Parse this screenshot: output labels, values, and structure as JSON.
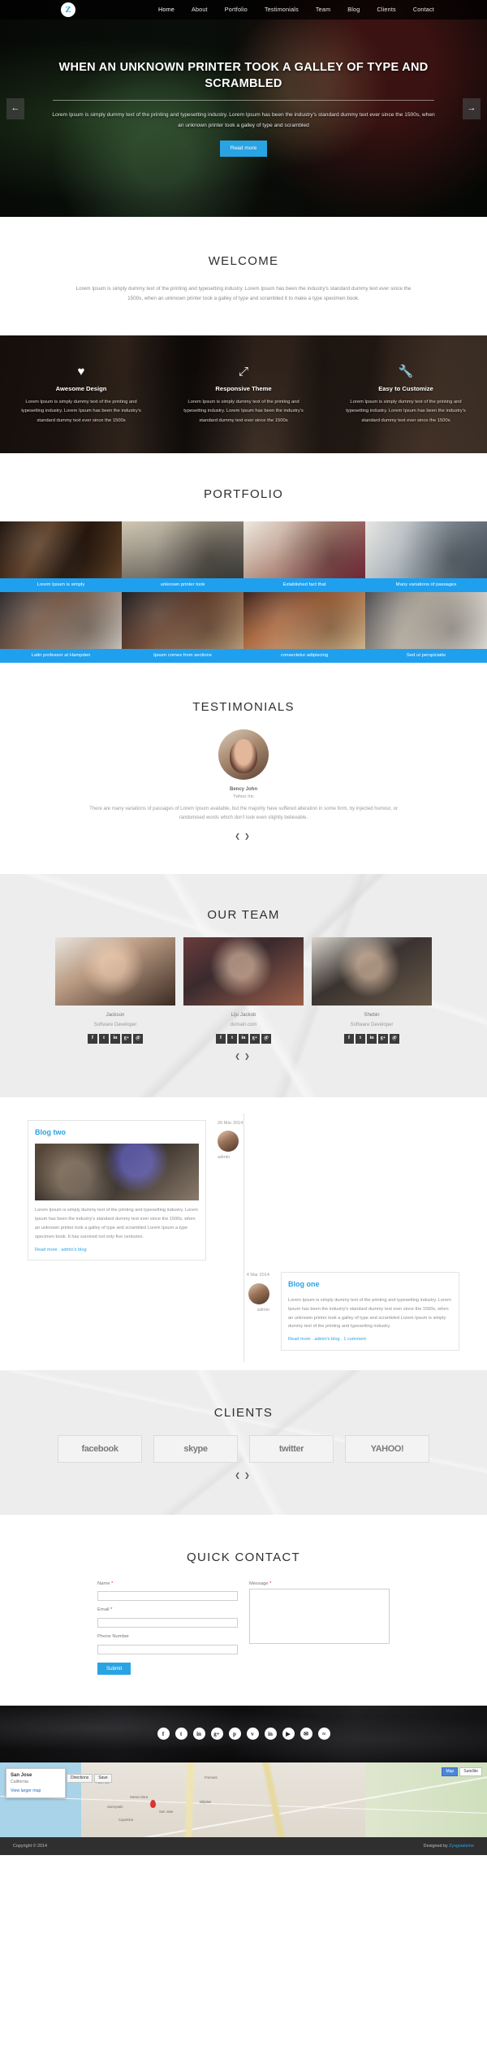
{
  "header": {
    "logo_text": "Z",
    "nav": [
      {
        "label": "Home"
      },
      {
        "label": "About"
      },
      {
        "label": "Portfolio"
      },
      {
        "label": "Testimonials"
      },
      {
        "label": "Team"
      },
      {
        "label": "Blog"
      },
      {
        "label": "Clients"
      },
      {
        "label": "Contact"
      }
    ]
  },
  "hero": {
    "title": "WHEN AN UNKNOWN PRINTER TOOK A GALLEY OF TYPE AND SCRAMBLED",
    "paragraph": "Lorem Ipsum is simply dummy text of the printing and typesetting industry. Lorem Ipsum has been the industry's standard dummy text ever since the 1500s, when an unknown printer took a galley of type and scrambled",
    "button": "Read more",
    "prev_arrow": "←",
    "next_arrow": "→"
  },
  "welcome": {
    "title": "WELCOME",
    "paragraph": "Lorem Ipsum is simply dummy text of the printing and typesetting industry. Lorem Ipsum has been the industry's standard dummy text ever since the 1500s, when an unknown printer took a galley of type and scrambled it to make a type specimen book."
  },
  "features": [
    {
      "icon": "♥",
      "icon_name": "heart-icon",
      "title": "Awesome Design",
      "text": "Lorem Ipsum is simply dummy text of the printing and typesetting industry. Lorem Ipsum has been the industry's standard dummy text ever since the 1500s"
    },
    {
      "icon": "⤢",
      "icon_name": "expand-arrows-icon",
      "title": "Responsive Theme",
      "text": "Lorem Ipsum is simply dummy text of the printing and typesetting industry. Lorem Ipsum has been the industry's standard dummy text ever since the 1500s"
    },
    {
      "icon": "🔧",
      "icon_name": "wrench-icon",
      "title": "Easy to Customize",
      "text": "Lorem Ipsum is simply dummy text of the printing and typesetting industry. Lorem Ipsum has been the industry's standard dummy text ever since the 1500s"
    }
  ],
  "portfolio": {
    "title": "PORTFOLIO",
    "items": [
      {
        "caption": "Lorem Ipsum is simply"
      },
      {
        "caption": "unknown printer took"
      },
      {
        "caption": "Established fact that"
      },
      {
        "caption": "Many variations of passages"
      },
      {
        "caption": "Latin professor at Hampden"
      },
      {
        "caption": "Ipsum comes from sections"
      },
      {
        "caption": "consectetur adipiscing"
      },
      {
        "caption": "Sed ut perspiciatis"
      }
    ]
  },
  "testimonials": {
    "title": "TESTIMONIALS",
    "name": "Bency John",
    "company": "Yahoo Inc",
    "quote": "There are many variations of passages of Lorem Ipsum available, but the majority have suffered alteration in some form, by injected humour, or randomised words which don't look even slightly believable.",
    "prev": "❮",
    "next": "❯"
  },
  "team": {
    "title": "OUR TEAM",
    "members": [
      {
        "name": "Jackson",
        "role": "Software Developer"
      },
      {
        "name": "Liju Jackob",
        "role": "domain.com"
      },
      {
        "name": "Shebin",
        "role": "Software Developer"
      }
    ],
    "socials": [
      "f",
      "t",
      "in",
      "g+",
      "@"
    ],
    "social_names": [
      "facebook-icon",
      "twitter-icon",
      "linkedin-icon",
      "google-plus-icon",
      "email-icon"
    ],
    "prev": "❮",
    "next": "❯"
  },
  "blog": {
    "posts": [
      {
        "title": "Blog two",
        "date": "26 Mar 2014",
        "author": "admin",
        "body": "Lorem Ipsum is simply dummy text of the printing and typesetting industry. Lorem Ipsum has been the industry's standard dummy text ever since the 1500s, when an unknown printer took a galley of type and scrambled Lorem Ipsum a type specimen book. It has survived not only five centuries.",
        "links": "Read more . admin's blog"
      },
      {
        "title": "Blog one",
        "date": "4 Mar 2014",
        "author": "admin",
        "body": "Lorem Ipsum is simply dummy text of the printing and typesetting industry. Lorem Ipsum has been the industry's standard dummy text ever since the 1500s, when an unknown printer took a galley of type and scrambled Lorem Ipsum is simply dummy text of the printing and typesetting industry.",
        "links": "Read more . admin's blog . 1 comment"
      }
    ]
  },
  "clients": {
    "title": "CLIENTS",
    "logos": [
      "facebook",
      "skype",
      "twitter",
      "YAHOO!"
    ],
    "prev": "❮",
    "next": "❯"
  },
  "contact": {
    "title": "QUICK CONTACT",
    "name_label": "Name",
    "email_label": "Email",
    "phone_label": "Phone Number",
    "message_label": "Message",
    "required_mark": "*",
    "name_value": "",
    "email_value": "",
    "phone_value": "",
    "message_value": "",
    "submit": "Submit"
  },
  "footer": {
    "socials": [
      "f",
      "t",
      "in",
      "g+",
      "p",
      "v",
      "in",
      "▶",
      "✉",
      "≈"
    ],
    "social_names": [
      "facebook-icon",
      "twitter-icon",
      "linkedin-icon",
      "google-plus-icon",
      "pinterest-icon",
      "vimeo-icon",
      "instagram-icon",
      "youtube-icon",
      "email-icon",
      "rss-icon"
    ],
    "copyright": "Copyright © 2014",
    "credit_prefix": "Designed by ",
    "credit_link": "Zyxgrastsme"
  },
  "map": {
    "card_title": "San Jose",
    "card_sub": "California",
    "card_link": "View larger map",
    "tab_map": "Map",
    "tab_satellite": "Satellite",
    "btn_directions": "Directions",
    "btn_save": "Save",
    "labels": [
      "Palo Alto",
      "Fremont",
      "Santa Clara",
      "San Jose",
      "Milpitas",
      "Sunnyvale",
      "Cupertino"
    ]
  },
  "colors": {
    "accent": "#29a3e3",
    "portfolio_caption": "#1ea0ef",
    "dark": "#2f2f2f"
  }
}
